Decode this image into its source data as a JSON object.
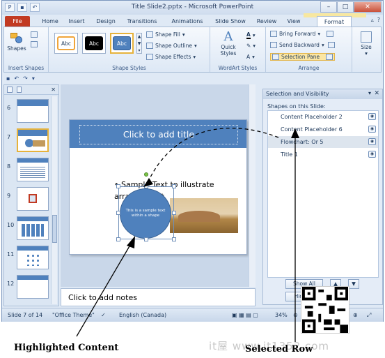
{
  "window": {
    "title": "Title Slide2.pptx - Microsoft PowerPoint",
    "controls": [
      "–",
      "□",
      "✕"
    ]
  },
  "tabs": [
    {
      "label": "File"
    },
    {
      "label": "Home"
    },
    {
      "label": "Insert"
    },
    {
      "label": "Design"
    },
    {
      "label": "Transitions"
    },
    {
      "label": "Animations"
    },
    {
      "label": "Slide Show"
    },
    {
      "label": "Review"
    },
    {
      "label": "View"
    },
    {
      "label": "Format"
    }
  ],
  "ribbon": {
    "insert_shapes": {
      "shapes_label": "Shapes",
      "group_label": "Insert Shapes"
    },
    "shape_styles": {
      "presets": [
        "Abc",
        "Abc",
        "Abc"
      ],
      "fill": "Shape Fill",
      "outline": "Shape Outline",
      "effects": "Shape Effects",
      "group_label": "Shape Styles"
    },
    "wordart": {
      "quick_styles": "Quick Styles",
      "group_label": "WordArt Styles"
    },
    "arrange": {
      "bring_forward": "Bring Forward",
      "send_backward": "Send Backward",
      "selection_pane": "Selection Pane",
      "group_label": "Arrange"
    },
    "size": {
      "label": "Size"
    }
  },
  "thumbnails": [
    {
      "num": "6"
    },
    {
      "num": "7"
    },
    {
      "num": "8"
    },
    {
      "num": "9"
    },
    {
      "num": "10"
    },
    {
      "num": "11"
    },
    {
      "num": "12"
    }
  ],
  "slide": {
    "title_placeholder": "Click to add title",
    "bullet_text": "• Sample Text to illustrate arrangement",
    "shape_text": "This is a sample text within a shape"
  },
  "notes": {
    "placeholder": "Click to add notes"
  },
  "selection_pane": {
    "title": "Selection and Visibility",
    "subtitle": "Shapes on this Slide:",
    "shapes": [
      {
        "name": "Content Placeholder 2"
      },
      {
        "name": "Content Placeholder 6"
      },
      {
        "name": "Flowchart: Or 5"
      },
      {
        "name": "Title 1"
      }
    ],
    "show_all": "Show All",
    "hide_all": "Hide All"
  },
  "status": {
    "slide": "Slide 7 of 14",
    "theme": "\"Office Theme\"",
    "language": "English (Canada)",
    "zoom": "34%"
  },
  "annotations": {
    "highlighted": "Highlighted Content",
    "selected_row": "Selected Row"
  },
  "watermark": "it屋 www.it1352.com",
  "colors": {
    "accent": "#4f81bd",
    "file_tab": "#c23a22",
    "selected_pane_button": "#fbe6a3"
  }
}
